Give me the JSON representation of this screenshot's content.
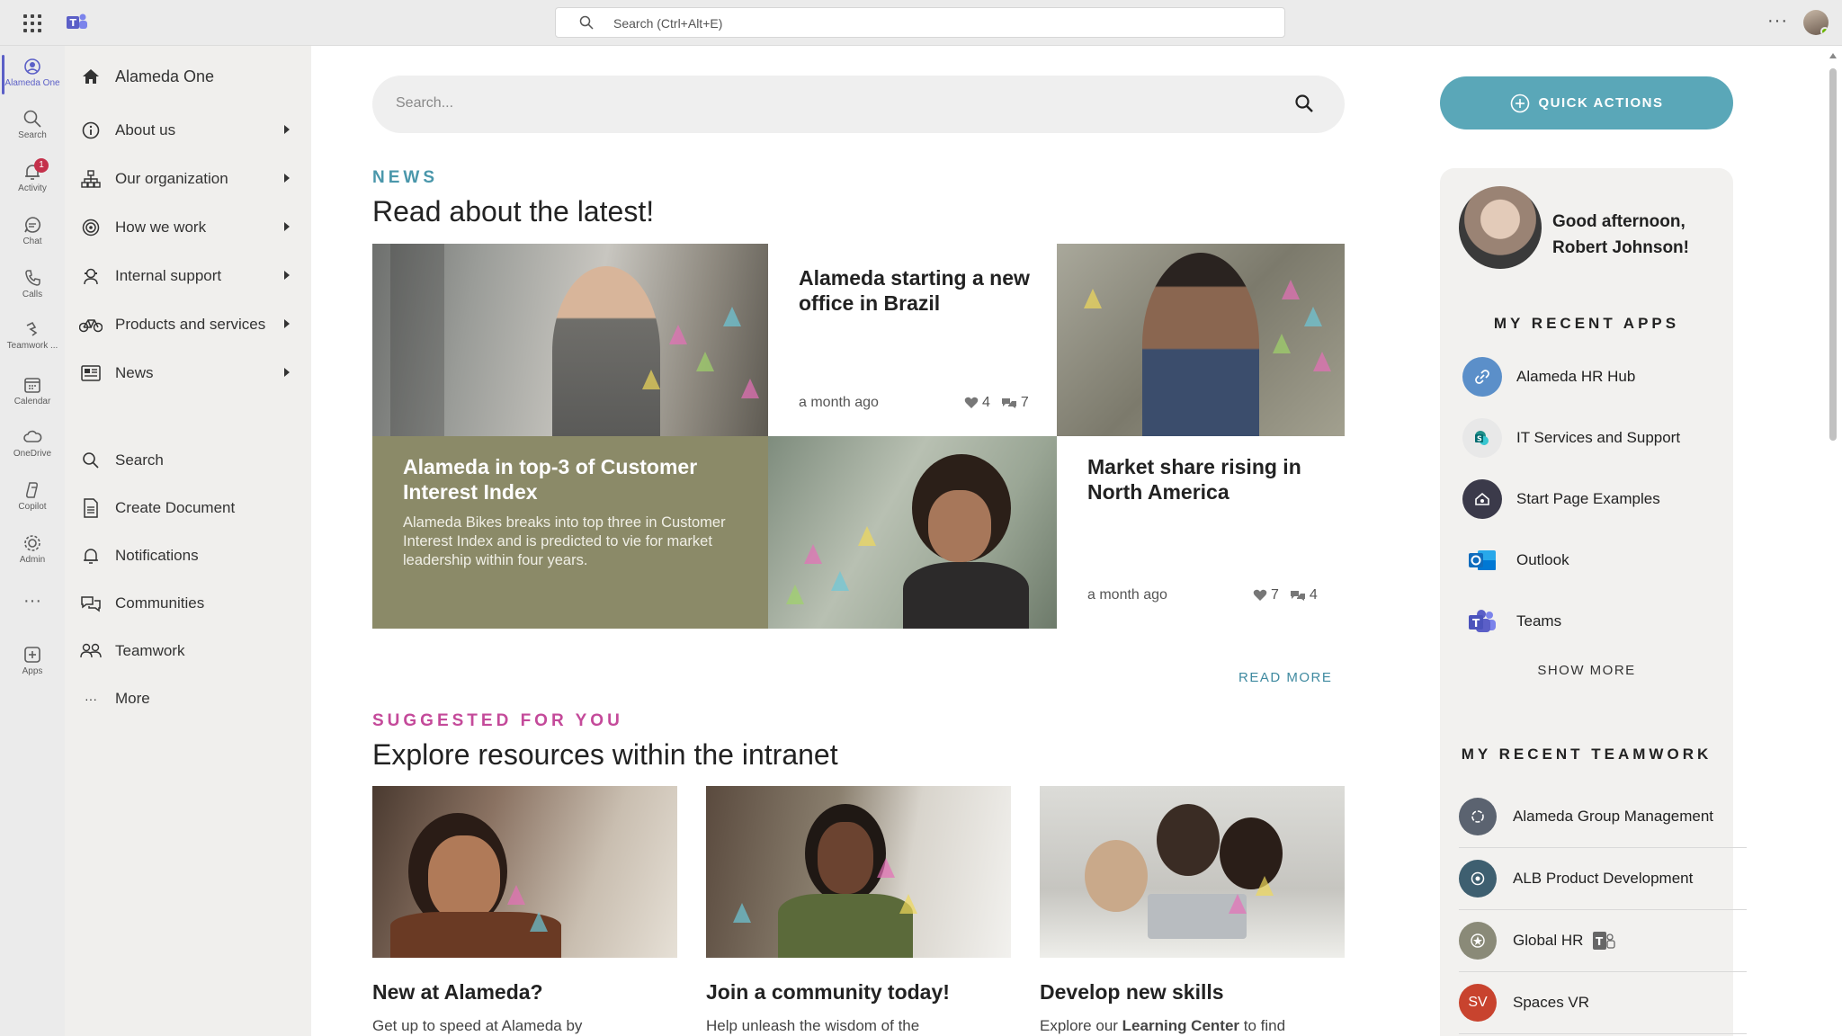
{
  "topbar": {
    "search_placeholder": "Search (Ctrl+Alt+E)",
    "more_label": "···"
  },
  "rail": [
    {
      "label": "Alameda One",
      "icon": "alameda-one-icon"
    },
    {
      "label": "Search",
      "icon": "search-icon"
    },
    {
      "label": "Activity",
      "icon": "bell-icon",
      "badge": "1"
    },
    {
      "label": "Chat",
      "icon": "chat-icon"
    },
    {
      "label": "Calls",
      "icon": "phone-icon"
    },
    {
      "label": "Teamwork ...",
      "icon": "teamwork-icon"
    },
    {
      "label": "Calendar",
      "icon": "calendar-icon"
    },
    {
      "label": "OneDrive",
      "icon": "cloud-icon"
    },
    {
      "label": "Copilot",
      "icon": "copilot-icon"
    },
    {
      "label": "Admin",
      "icon": "admin-icon"
    },
    {
      "label": "···",
      "icon": "more-icon"
    },
    {
      "label": "Apps",
      "icon": "apps-icon"
    }
  ],
  "leftnav": {
    "home": "Alameda One",
    "items": [
      {
        "label": "About us",
        "icon": "info-icon"
      },
      {
        "label": "Our organization",
        "icon": "org-chart-icon"
      },
      {
        "label": "How we work",
        "icon": "target-icon"
      },
      {
        "label": "Internal support",
        "icon": "support-icon"
      },
      {
        "label": "Products and services",
        "icon": "bicycle-icon"
      },
      {
        "label": "News",
        "icon": "newspaper-icon"
      }
    ],
    "tools": [
      {
        "label": "Search",
        "icon": "search-icon"
      },
      {
        "label": "Create Document",
        "icon": "document-icon"
      },
      {
        "label": "Notifications",
        "icon": "bell-icon"
      },
      {
        "label": "Communities",
        "icon": "chat-bubbles-icon"
      },
      {
        "label": "Teamwork",
        "icon": "people-icon"
      },
      {
        "label": "More",
        "icon": "more-icon"
      }
    ]
  },
  "main": {
    "search_placeholder": "Search...",
    "news": {
      "eyebrow": "NEWS",
      "heading": "Read about the latest!",
      "articles": [
        {
          "title": "Alameda starting a new office in Brazil",
          "time": "a month ago",
          "likes": "4",
          "comments": "7"
        },
        {
          "title": "Alameda in top-3 of Customer Interest Index",
          "desc": "Alameda Bikes breaks into top three in Customer Interest Index and is predicted to vie for market leadership within four years."
        },
        {
          "title": "Market share rising in North America",
          "time": "a month ago",
          "likes": "7",
          "comments": "4"
        }
      ],
      "read_more": "READ MORE"
    },
    "suggested": {
      "eyebrow": "SUGGESTED FOR YOU",
      "heading": "Explore resources within the intranet",
      "cards": [
        {
          "title": "New at Alameda?",
          "desc": "Get up to speed at Alameda by"
        },
        {
          "title": "Join a community today!",
          "desc": "Help unleash the wisdom of the"
        },
        {
          "title": "Develop new skills",
          "desc_before": "Explore our ",
          "desc_bold": "Learning Center",
          "desc_after": " to find"
        }
      ]
    }
  },
  "right": {
    "quick_actions": "QUICK ACTIONS",
    "greeting_line1": "Good afternoon,",
    "greeting_line2": "Robert Johnson!",
    "recent_apps_title": "MY RECENT APPS",
    "recent_apps": [
      {
        "label": "Alameda HR Hub",
        "icon": "link-icon",
        "color": "#5b8fc9"
      },
      {
        "label": "IT Services and Support",
        "icon": "sharepoint-icon",
        "color": "#e8e8e8"
      },
      {
        "label": "Start Page Examples",
        "icon": "home-shield-icon",
        "color": "#3b3a4a"
      },
      {
        "label": "Outlook",
        "icon": "outlook-icon",
        "color": "#0f6cbd"
      },
      {
        "label": "Teams",
        "icon": "teams-icon",
        "color": "#5b5fc7"
      }
    ],
    "show_more": "SHOW MORE",
    "recent_teamwork_title": "MY RECENT TEAMWORK",
    "recent_teamwork": [
      {
        "label": "Alameda Group Management",
        "color": "#5b6370"
      },
      {
        "label": "ALB Product Development",
        "color": "#3e5f70"
      },
      {
        "label": "Global HR",
        "color": "#8a8a78"
      },
      {
        "label": "Spaces VR",
        "initials": "SV",
        "color": "#c8432e"
      }
    ]
  }
}
